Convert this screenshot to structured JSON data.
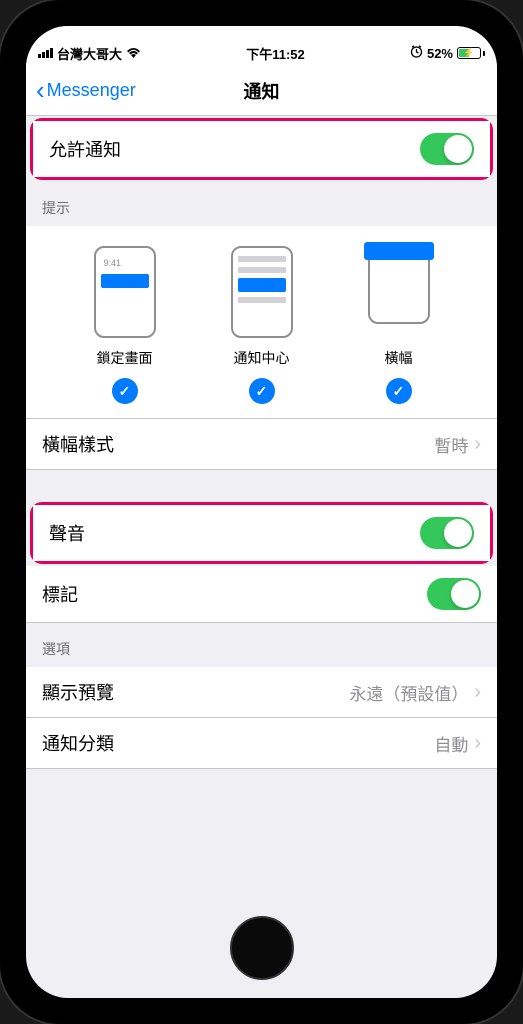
{
  "statusBar": {
    "carrier": "台灣大哥大",
    "time": "下午11:52",
    "batteryPercent": "52%"
  },
  "nav": {
    "back": "Messenger",
    "title": "通知"
  },
  "allowNotifications": {
    "label": "允許通知"
  },
  "alerts": {
    "header": "提示",
    "lockScreen": "鎖定畫面",
    "notificationCenter": "通知中心",
    "banners": "橫幅"
  },
  "bannerStyle": {
    "label": "橫幅樣式",
    "value": "暫時"
  },
  "sounds": {
    "label": "聲音"
  },
  "badges": {
    "label": "標記"
  },
  "options": {
    "header": "選項",
    "showPreviews": {
      "label": "顯示預覽",
      "value": "永遠（預設值）"
    },
    "grouping": {
      "label": "通知分類",
      "value": "自動"
    }
  }
}
